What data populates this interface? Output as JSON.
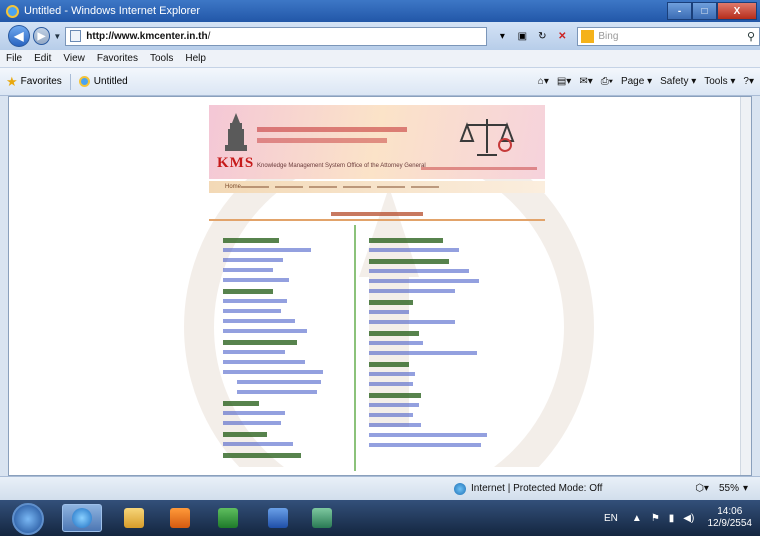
{
  "window": {
    "title": "Untitled - Windows Internet Explorer",
    "min": "-",
    "max": "□",
    "close": "X"
  },
  "address": {
    "url_domain": "http://www.kmcenter.in.th",
    "url_rest": "/",
    "search_placeholder": "Bing"
  },
  "menu": [
    "File",
    "Edit",
    "View",
    "Favorites",
    "Tools",
    "Help"
  ],
  "favorites": {
    "label": "Favorites",
    "tab_title": "Untitled"
  },
  "commands": [
    "Page ▾",
    "Safety ▾",
    "Tools ▾"
  ],
  "banner": {
    "brand": "KMS",
    "subtitle": "Knowledge Management System  Office of the Attorney General"
  },
  "nav_strip": "Home",
  "status": {
    "zone": "Internet | Protected Mode: Off",
    "zoom": "55%"
  },
  "taskbar": {
    "lang": "EN",
    "time": "14:06",
    "date": "12/9/2554"
  },
  "colors": {
    "accent": "#c61a1a",
    "group_heading": "#1f5a12",
    "link": "#3a52c4",
    "divider": "#8bc27a"
  }
}
